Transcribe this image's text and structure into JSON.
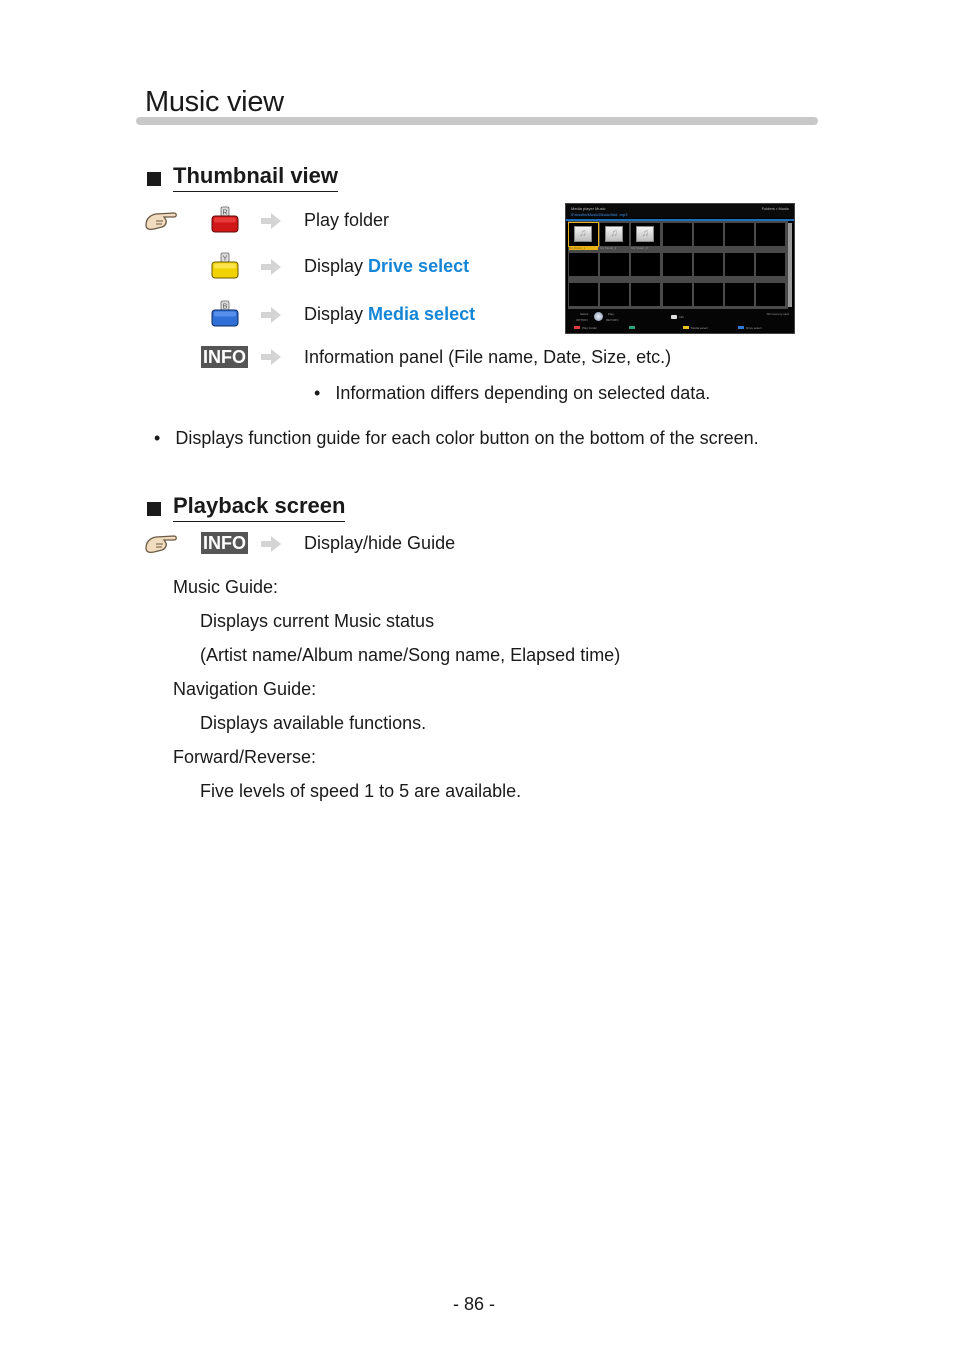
{
  "page": {
    "title": "Music view",
    "page_number": "- 86 -"
  },
  "thumbnail_view": {
    "heading": "Thumbnail view",
    "rows": [
      {
        "key": "red-button",
        "key_label": "R",
        "key_color": "#d01818",
        "text": "Play folder",
        "link": ""
      },
      {
        "key": "yellow-button",
        "key_label": "Y",
        "key_color": "#f0d200",
        "text": "Display ",
        "link": "Drive select"
      },
      {
        "key": "blue-button",
        "key_label": "B",
        "key_color": "#2f6fd6",
        "text": "Display ",
        "link": "Media select"
      },
      {
        "key": "info-button",
        "key_label": "INFO",
        "text": "Information panel (File name, Date, Size, etc.)",
        "link": ""
      }
    ],
    "sub_bullet": "Information differs depending on selected data.",
    "note": "Displays function guide for each color button on the bottom of the screen."
  },
  "screenshot": {
    "header_left": "Media player   Music",
    "header_right": "Folders • Music",
    "path": "/Favorite/Music/Music/### .mp3",
    "thumbs": [
      {
        "caption": "My Music_1",
        "selected": true
      },
      {
        "caption": "My Music_2",
        "selected": false
      },
      {
        "caption": "My Music_3",
        "selected": false
      }
    ],
    "footer": {
      "select": "Select",
      "play": "Play",
      "option": "OPTION",
      "return": "RETURN",
      "info": "Info",
      "device": "SD memory card",
      "red": "Play Folder",
      "yellow": "Media select",
      "blue": "Drive select"
    }
  },
  "playback_screen": {
    "heading": "Playback screen",
    "key_label": "INFO",
    "action": "Display/hide Guide",
    "items": [
      {
        "term": "Music Guide:",
        "desc": [
          "Displays current Music status",
          "(Artist name/Album name/Song name, Elapsed time)"
        ]
      },
      {
        "term": "Navigation Guide:",
        "desc": [
          "Displays available functions."
        ]
      },
      {
        "term": "Forward/Reverse:",
        "desc": [
          "Five levels of speed 1 to 5 are available."
        ]
      }
    ]
  },
  "colors": {
    "link": "#1585d6",
    "info_key_bg": "#555555",
    "title_rule": "#c8c8c8"
  }
}
